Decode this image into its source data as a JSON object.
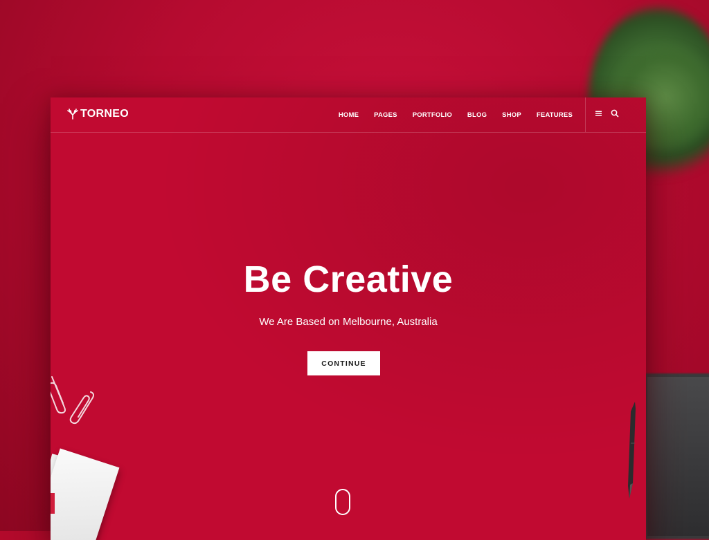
{
  "brand": {
    "name": "TORNEO",
    "logo_icon": "antlers-icon"
  },
  "nav": {
    "items": [
      {
        "label": "HOME"
      },
      {
        "label": "PAGES"
      },
      {
        "label": "PORTFOLIO"
      },
      {
        "label": "BLOG"
      },
      {
        "label": "SHOP"
      },
      {
        "label": "FEATURES"
      }
    ],
    "menu_icon": "hamburger-menu-icon",
    "search_icon": "search-icon"
  },
  "hero": {
    "title": "Be Creative",
    "subtitle": "We Are Based on Melbourne, Australia",
    "cta_label": "CONTINUE"
  },
  "colors": {
    "accent": "#c10a31",
    "background": "#b40a2c",
    "button_bg": "#ffffff",
    "text": "#ffffff"
  }
}
